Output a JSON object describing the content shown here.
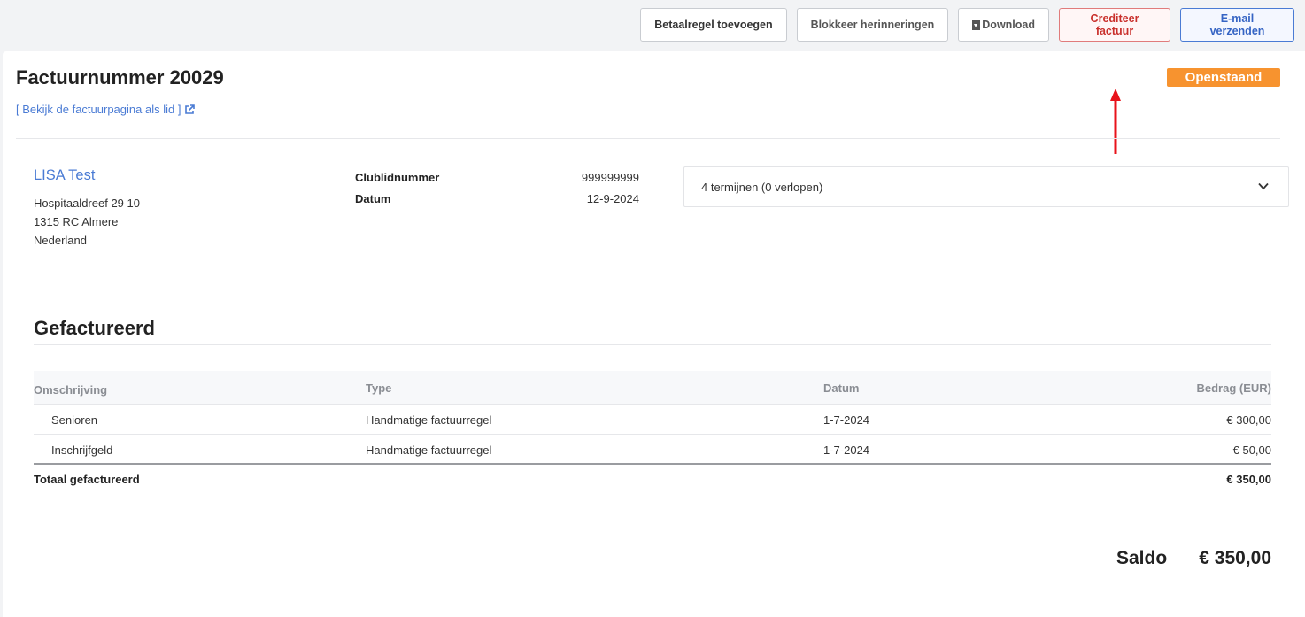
{
  "toolbar": {
    "add_payment_line": "Betaalregel toevoegen",
    "block_reminders": "Blokkeer herinneringen",
    "download": "Download",
    "credit_invoice": "Crediteer factuur",
    "send_email": "E-mail verzenden"
  },
  "invoice": {
    "title": "Factuurnummer 20029",
    "member_link": "[ Bekijk de factuurpagina als lid ]",
    "status": "Openstaand"
  },
  "member": {
    "name": "LISA Test",
    "address_line1": "Hospitaaldreef 29 10",
    "address_line2": "1315 RC Almere",
    "country": "Nederland"
  },
  "meta": {
    "club_number_label": "Clublidnummer",
    "club_number_value": "999999999",
    "date_label": "Datum",
    "date_value": "12-9-2024"
  },
  "terms": {
    "label": "4 termijnen (0 verlopen)"
  },
  "billed": {
    "section_title": "Gefactureerd",
    "columns": [
      "Omschrijving",
      "Type",
      "Datum",
      "Bedrag (EUR)"
    ],
    "rows": [
      {
        "description": "Senioren",
        "type": "Handmatige factuurregel",
        "date": "1-7-2024",
        "amount": "€ 300,00"
      },
      {
        "description": "Inschrijfgeld",
        "type": "Handmatige factuurregel",
        "date": "1-7-2024",
        "amount": "€ 50,00"
      }
    ],
    "total_label": "Totaal gefactureerd",
    "total_amount": "€ 350,00"
  },
  "balance": {
    "label": "Saldo",
    "value": "€ 350,00"
  },
  "colors": {
    "accent": "#4a7bd4",
    "status": "#f7932f",
    "danger": "#c9302c",
    "annotation_arrow": "#e8131b"
  }
}
